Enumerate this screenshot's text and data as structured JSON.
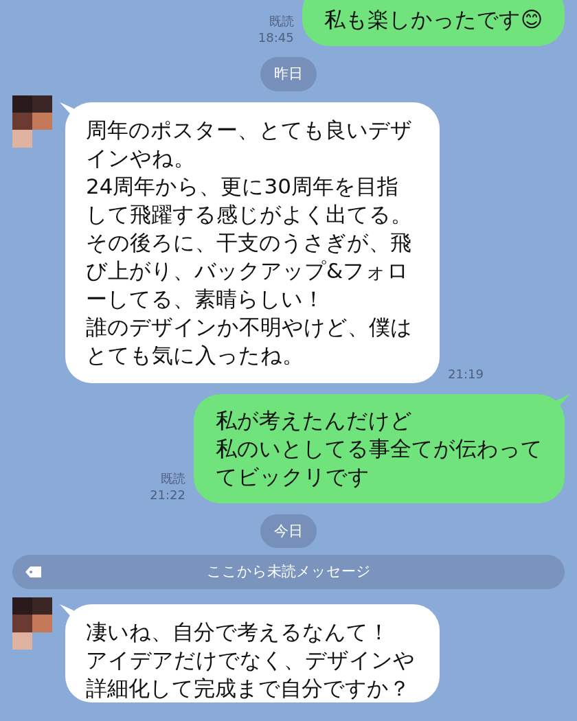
{
  "messages": [
    {
      "kind": "outgoing",
      "lines": [
        "私も楽しかったです😊"
      ],
      "read": "既読",
      "time": "18:45"
    },
    {
      "kind": "date",
      "label": "昨日"
    },
    {
      "kind": "incoming",
      "lines": [
        "周年のポスター、とても良いデザ",
        "インやね。",
        "24周年から、更に30周年を目指",
        "して飛躍する感じがよく出てる。",
        "その後ろに、干支のうさぎが、飛",
        "び上がり、バックアップ&フォロ",
        "ーしてる、素晴らしい！",
        "誰のデザインか不明やけど、僕は",
        "とても気に入ったね。"
      ],
      "time": "21:19"
    },
    {
      "kind": "outgoing",
      "lines": [
        "私が考えたんだけど",
        "私のいとしてる事全てが伝わって",
        "てビックリです"
      ],
      "read": "既読",
      "time": "21:22"
    },
    {
      "kind": "date",
      "label": "今日"
    },
    {
      "kind": "unread",
      "label": "ここから未読メッセージ"
    },
    {
      "kind": "incoming",
      "lines": [
        "凄いね、自分で考えるなんて！",
        "アイデアだけでなく、デザインや",
        "詳細化して完成まで自分ですか？"
      ]
    }
  ]
}
